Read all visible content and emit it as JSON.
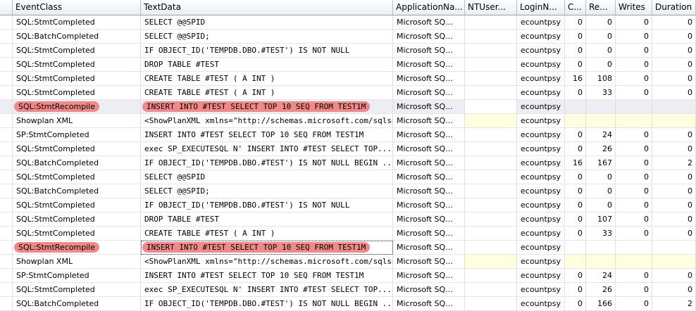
{
  "columns": [
    "EventClass",
    "TextData",
    "ApplicationNa...",
    "NTUser...",
    "LoginN...",
    "C...",
    "Re...",
    "Writes",
    "Duration"
  ],
  "colors": {
    "highlight": "#f08a8a",
    "yellow_cell": "#ffffe0",
    "selected_row": "#eceef3"
  },
  "rows": [
    {
      "event": "SQL:StmtCompleted",
      "text": "SELECT @@SPID",
      "app": "Microsoft SQ...",
      "nt": "",
      "login": "ecountpsy",
      "cpu": "0",
      "reads": "0",
      "writes": "0",
      "duration": "0"
    },
    {
      "event": "SQL:BatchCompleted",
      "text": "SELECT @@SPID;",
      "app": "Microsoft SQ...",
      "nt": "",
      "login": "ecountpsy",
      "cpu": "0",
      "reads": "0",
      "writes": "0",
      "duration": "0"
    },
    {
      "event": "SQL:StmtCompleted",
      "text": "IF OBJECT_ID('TEMPDB.DBO.#TEST') IS NOT NULL",
      "app": "Microsoft SQ...",
      "nt": "",
      "login": "ecountpsy",
      "cpu": "0",
      "reads": "0",
      "writes": "0",
      "duration": "0"
    },
    {
      "event": "SQL:StmtCompleted",
      "text": "DROP TABLE #TEST",
      "app": "Microsoft SQ...",
      "nt": "",
      "login": "ecountpsy",
      "cpu": "0",
      "reads": "0",
      "writes": "0",
      "duration": "0"
    },
    {
      "event": "SQL:StmtCompleted",
      "text": "CREATE TABLE #TEST  (  A INT  )",
      "app": "Microsoft SQ...",
      "nt": "",
      "login": "ecountpsy",
      "cpu": "16",
      "reads": "108",
      "writes": "0",
      "duration": "0"
    },
    {
      "event": "SQL:StmtCompleted",
      "text": "CREATE TABLE #TEST  (  A INT  )",
      "app": "Microsoft SQ...",
      "nt": "",
      "login": "ecountpsy",
      "cpu": "0",
      "reads": "33",
      "writes": "0",
      "duration": "0"
    },
    {
      "event": "SQL:StmtRecompile",
      "text": "INSERT INTO #TEST  SELECT TOP 10 SEQ FROM TEST1M",
      "app": "Microsoft SQ...",
      "nt": "",
      "login": "ecountpsy",
      "cpu": "",
      "reads": "",
      "writes": "",
      "duration": "",
      "highlight": true,
      "selected": true
    },
    {
      "event": "Showplan XML",
      "text": "<ShowPlanXML xmlns=\"http://schemas.microsoft.com/sqlse...",
      "app": "Microsoft SQ...",
      "nt": "",
      "login": "ecountpsy",
      "cpu": "",
      "reads": "",
      "writes": "",
      "duration": "",
      "yellow": true
    },
    {
      "event": "SP:StmtCompleted",
      "text": "INSERT INTO #TEST  SELECT TOP 10 SEQ FROM TEST1M",
      "app": "Microsoft SQ...",
      "nt": "",
      "login": "ecountpsy",
      "cpu": "0",
      "reads": "24",
      "writes": "0",
      "duration": "0"
    },
    {
      "event": "SQL:StmtCompleted",
      "text": "exec SP_EXECUTESQL N'  INSERT INTO #TEST  SELECT TOP...",
      "app": "Microsoft SQ...",
      "nt": "",
      "login": "ecountpsy",
      "cpu": "0",
      "reads": "26",
      "writes": "0",
      "duration": "0"
    },
    {
      "event": "SQL:BatchCompleted",
      "text": "IF OBJECT_ID('TEMPDB.DBO.#TEST') IS NOT NULL  BEGIN ...",
      "app": "Microsoft SQ...",
      "nt": "",
      "login": "ecountpsy",
      "cpu": "16",
      "reads": "167",
      "writes": "0",
      "duration": "2"
    },
    {
      "event": "SQL:StmtCompleted",
      "text": "SELECT @@SPID",
      "app": "Microsoft SQ...",
      "nt": "",
      "login": "ecountpsy",
      "cpu": "0",
      "reads": "0",
      "writes": "0",
      "duration": "0"
    },
    {
      "event": "SQL:BatchCompleted",
      "text": "SELECT @@SPID;",
      "app": "Microsoft SQ...",
      "nt": "",
      "login": "ecountpsy",
      "cpu": "0",
      "reads": "0",
      "writes": "0",
      "duration": "0"
    },
    {
      "event": "SQL:StmtCompleted",
      "text": "IF OBJECT_ID('TEMPDB.DBO.#TEST') IS NOT NULL",
      "app": "Microsoft SQ...",
      "nt": "",
      "login": "ecountpsy",
      "cpu": "0",
      "reads": "0",
      "writes": "0",
      "duration": "0"
    },
    {
      "event": "SQL:StmtCompleted",
      "text": "DROP TABLE #TEST",
      "app": "Microsoft SQ...",
      "nt": "",
      "login": "ecountpsy",
      "cpu": "0",
      "reads": "107",
      "writes": "0",
      "duration": "0"
    },
    {
      "event": "SQL:StmtCompleted",
      "text": "CREATE TABLE #TEST  (  A INT  )",
      "app": "Microsoft SQ...",
      "nt": "",
      "login": "ecountpsy",
      "cpu": "0",
      "reads": "33",
      "writes": "0",
      "duration": "0"
    },
    {
      "event": "SQL:StmtRecompile",
      "text": "INSERT INTO #TEST  SELECT TOP 10 SEQ FROM TEST1M",
      "app": "Microsoft SQ...",
      "nt": "",
      "login": "ecountpsy",
      "cpu": "",
      "reads": "",
      "writes": "",
      "duration": "",
      "highlight": true,
      "textfocus": true
    },
    {
      "event": "Showplan XML",
      "text": "<ShowPlanXML xmlns=\"http://schemas.microsoft.com/sqlse...",
      "app": "Microsoft SQ...",
      "nt": "",
      "login": "ecountpsy",
      "cpu": "",
      "reads": "",
      "writes": "",
      "duration": "",
      "yellow": true
    },
    {
      "event": "SP:StmtCompleted",
      "text": "INSERT INTO #TEST  SELECT TOP 10 SEQ FROM TEST1M",
      "app": "Microsoft SQ...",
      "nt": "",
      "login": "ecountpsy",
      "cpu": "0",
      "reads": "24",
      "writes": "0",
      "duration": "0"
    },
    {
      "event": "SQL:StmtCompleted",
      "text": "exec SP_EXECUTESQL N'  INSERT INTO #TEST  SELECT TOP...",
      "app": "Microsoft SQ...",
      "nt": "",
      "login": "ecountpsy",
      "cpu": "0",
      "reads": "26",
      "writes": "0",
      "duration": "0"
    },
    {
      "event": "SQL:BatchCompleted",
      "text": "IF OBJECT_ID('TEMPDB.DBO.#TEST') IS NOT NULL  BEGIN ...",
      "app": "Microsoft SQ...",
      "nt": "",
      "login": "ecountpsy",
      "cpu": "0",
      "reads": "166",
      "writes": "0",
      "duration": "2"
    }
  ]
}
